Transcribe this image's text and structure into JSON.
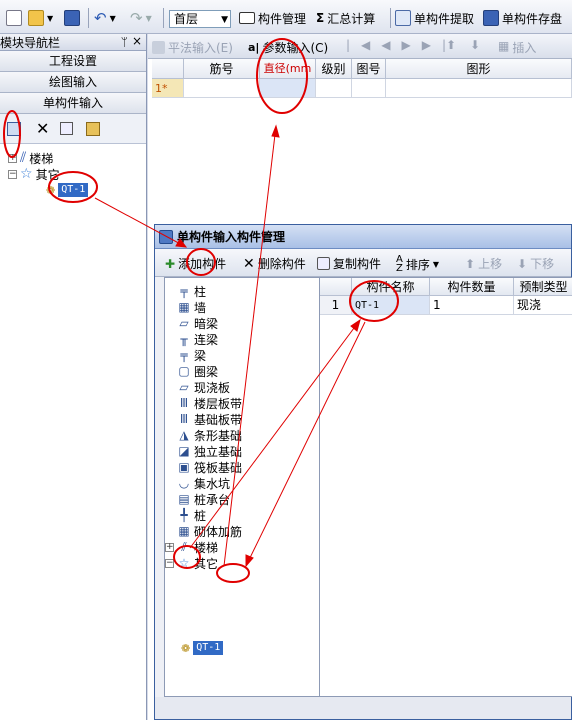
{
  "toolbar": {
    "floor_value": "首层",
    "component_manage": "构件管理",
    "sum_calc": "汇总计算",
    "single_extract": "单构件提取",
    "single_save": "单构件存盘"
  },
  "sidebar": {
    "title": "模块导航栏",
    "pin": "ᛘ",
    "close": "×",
    "nav_project_settings": "工程设置",
    "nav_drawing_input": "绘图输入",
    "nav_single_input": "单构件输入",
    "tree_stairs": "楼梯",
    "tree_other": "其它",
    "tree_item": "QT-1"
  },
  "main": {
    "toolbar_flat_input": "平法输入(E)",
    "toolbar_param_input": "参数输入(C)",
    "toolbar_insert": "插入",
    "columns": [
      "",
      "筋号",
      "直径(mm",
      "级别",
      "图号",
      "图形"
    ],
    "row1_index": "1*"
  },
  "dialog": {
    "title": "单构件输入构件管理",
    "add": "添加构件",
    "delete": "删除构件",
    "copy": "复制构件",
    "sort": "排序",
    "up": "上移",
    "down": "下移",
    "types": [
      "柱",
      "墙",
      "暗梁",
      "连梁",
      "梁",
      "圈梁",
      "现浇板",
      "楼层板带",
      "基础板带",
      "条形基础",
      "独立基础",
      "筏板基础",
      "集水坑",
      "桩承台",
      "桩",
      "砌体加筋",
      "楼梯",
      "其它"
    ],
    "tree_item": "QT-1",
    "grid_headers": [
      "",
      "构件名称",
      "构件数量",
      "预制类型"
    ],
    "row": {
      "index": "1",
      "name": "QT-1",
      "count": "1",
      "type": "现浇"
    }
  },
  "colors": {
    "annotation": "#e00000",
    "selection": "#316ac5"
  }
}
